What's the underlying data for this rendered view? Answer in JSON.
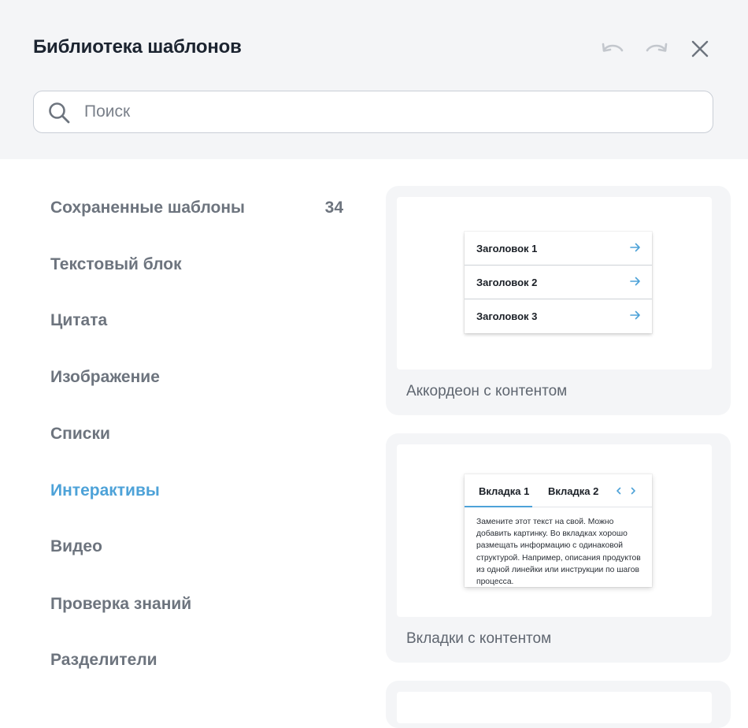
{
  "header": {
    "title": "Библиотека шаблонов",
    "undo_icon": "undo-icon",
    "redo_icon": "redo-icon",
    "close_icon": "close-icon"
  },
  "search": {
    "placeholder": "Поиск",
    "value": "",
    "icon": "search-icon"
  },
  "sidebar": {
    "items": [
      {
        "label": "Сохраненные шаблоны",
        "count": "34"
      },
      {
        "label": "Текстовый блок"
      },
      {
        "label": "Цитата"
      },
      {
        "label": "Изображение"
      },
      {
        "label": "Списки"
      },
      {
        "label": "Интерактивы",
        "active": true
      },
      {
        "label": "Видео"
      },
      {
        "label": "Проверка знаний"
      },
      {
        "label": "Разделители"
      }
    ]
  },
  "templates": [
    {
      "caption": "Аккордеон с контентом",
      "preview": {
        "rows": [
          "Заголовок 1",
          "Заголовок 2",
          "Заголовок 3"
        ]
      }
    },
    {
      "caption": "Вкладки с контентом",
      "preview": {
        "tabs": [
          "Вкладка 1",
          "Вкладка 2"
        ],
        "text": "Замените этот текст на свой. Можно добавить картинку. Во вкладках хорошо размещать информацию с одинаковой структурой. Например, описания продуктов из одной линейки или инструкции по шагов процесса."
      }
    }
  ],
  "colors": {
    "accent": "#4da2d8",
    "header_bg": "#f4f5f7",
    "text_muted": "#6d747e",
    "title": "#1c2430"
  }
}
